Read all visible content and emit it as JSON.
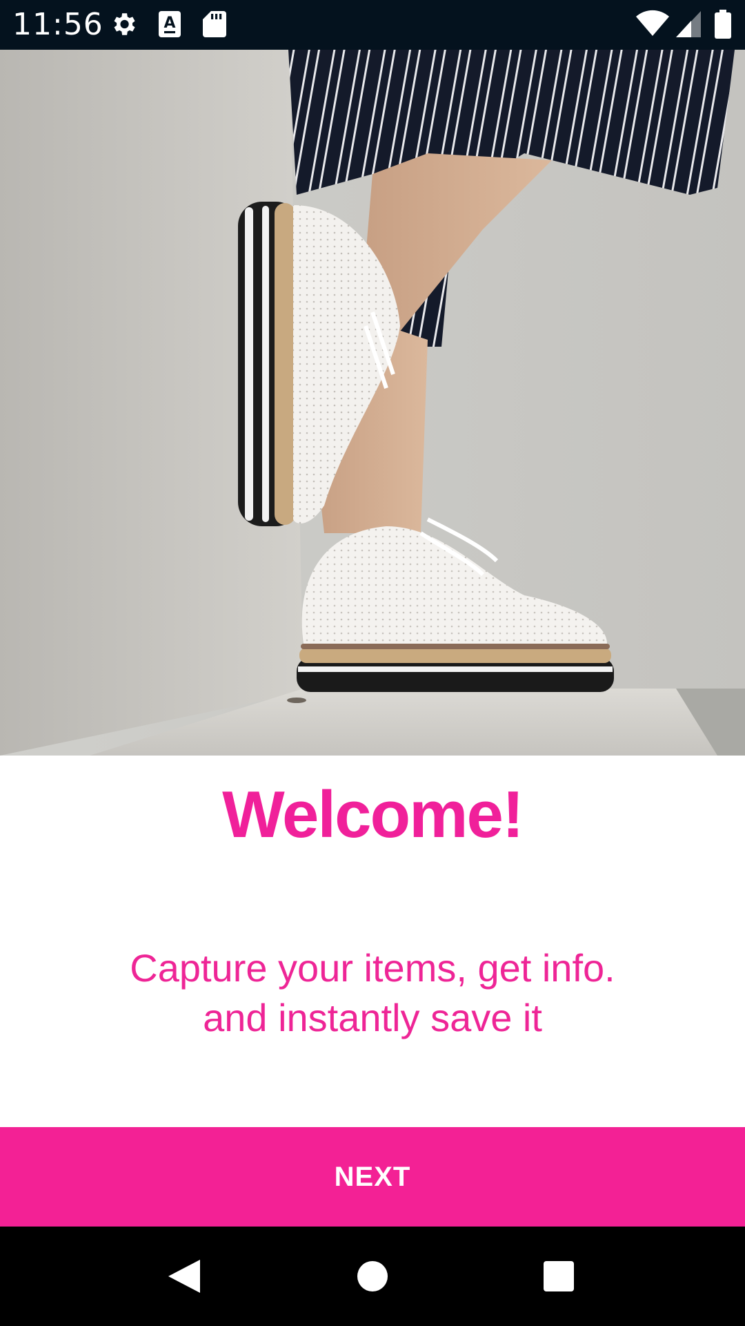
{
  "status_bar": {
    "time": "11:56",
    "icons": [
      "gear-icon",
      "text-a-icon",
      "sd-card-icon",
      "wifi-icon",
      "signal-icon",
      "battery-icon"
    ]
  },
  "hero": {
    "image": "photo-white-brogue-platform-shoes-striped-pants-concrete-wall"
  },
  "welcome": {
    "title": "Welcome!",
    "subtitle_line1": "Capture your items, get info.",
    "subtitle_line2": "and instantly save it"
  },
  "next_button": {
    "label": "NEXT"
  },
  "nav_bar": {
    "icons": [
      "back-icon",
      "home-icon",
      "recents-icon"
    ]
  },
  "colors": {
    "accent": "#f32195",
    "title": "#f0209a",
    "status_bar": "#04121e",
    "nav_bar": "#000000"
  }
}
